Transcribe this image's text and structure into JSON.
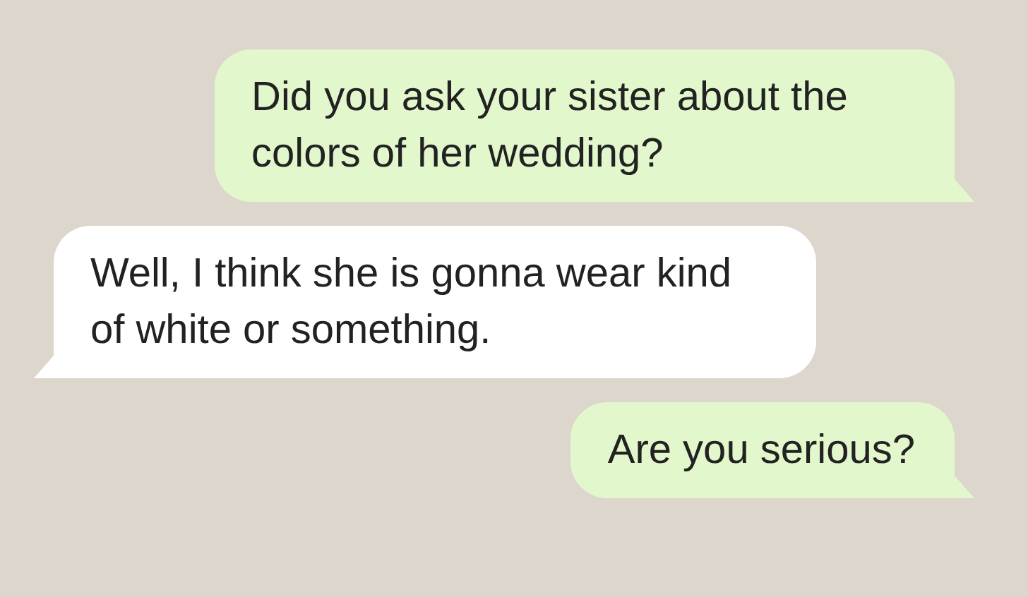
{
  "messages": [
    {
      "kind": "outgoing",
      "text": "Did you ask your sister about the colors of her wedding?"
    },
    {
      "kind": "incoming",
      "text": "Well, I think she is gonna wear kind of white or something."
    },
    {
      "kind": "outgoing",
      "text": "Are you serious?"
    }
  ]
}
